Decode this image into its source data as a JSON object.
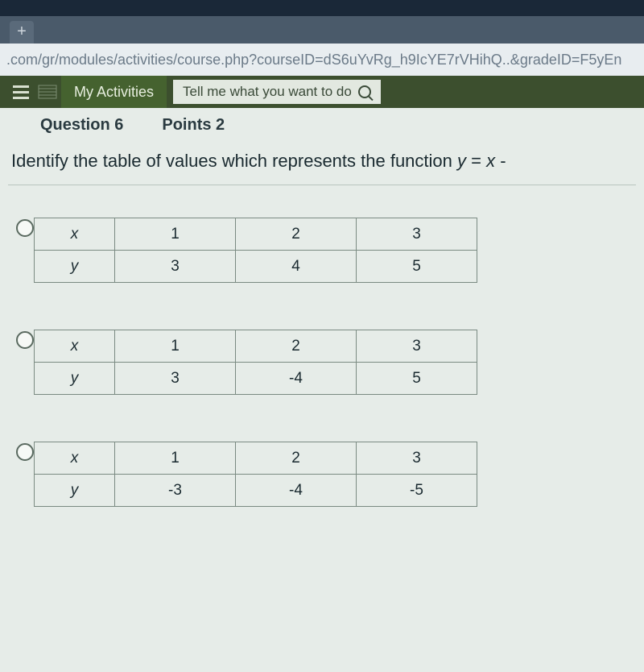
{
  "browser": {
    "url": ".com/gr/modules/activities/course.php?courseID=dS6uYvRg_h9IcYE7rVHihQ..&gradeID=F5yEn"
  },
  "nav": {
    "my_activities": "My Activities",
    "tell_me": "Tell me what you want to do"
  },
  "question": {
    "label": "Question 6",
    "points": "Points 2",
    "prompt_a": "Identify the table of values which represents the function ",
    "prompt_eq_lhs": "y",
    "prompt_eq_mid": " = ",
    "prompt_eq_rhs": "x"
  },
  "tables": [
    {
      "x": [
        "1",
        "2",
        "3"
      ],
      "y": [
        "3",
        "4",
        "5"
      ]
    },
    {
      "x": [
        "1",
        "2",
        "3"
      ],
      "y": [
        "3",
        "-4",
        "5"
      ]
    },
    {
      "x": [
        "1",
        "2",
        "3"
      ],
      "y": [
        "-3",
        "-4",
        "-5"
      ]
    }
  ],
  "labels": {
    "x": "x",
    "y": "y"
  }
}
